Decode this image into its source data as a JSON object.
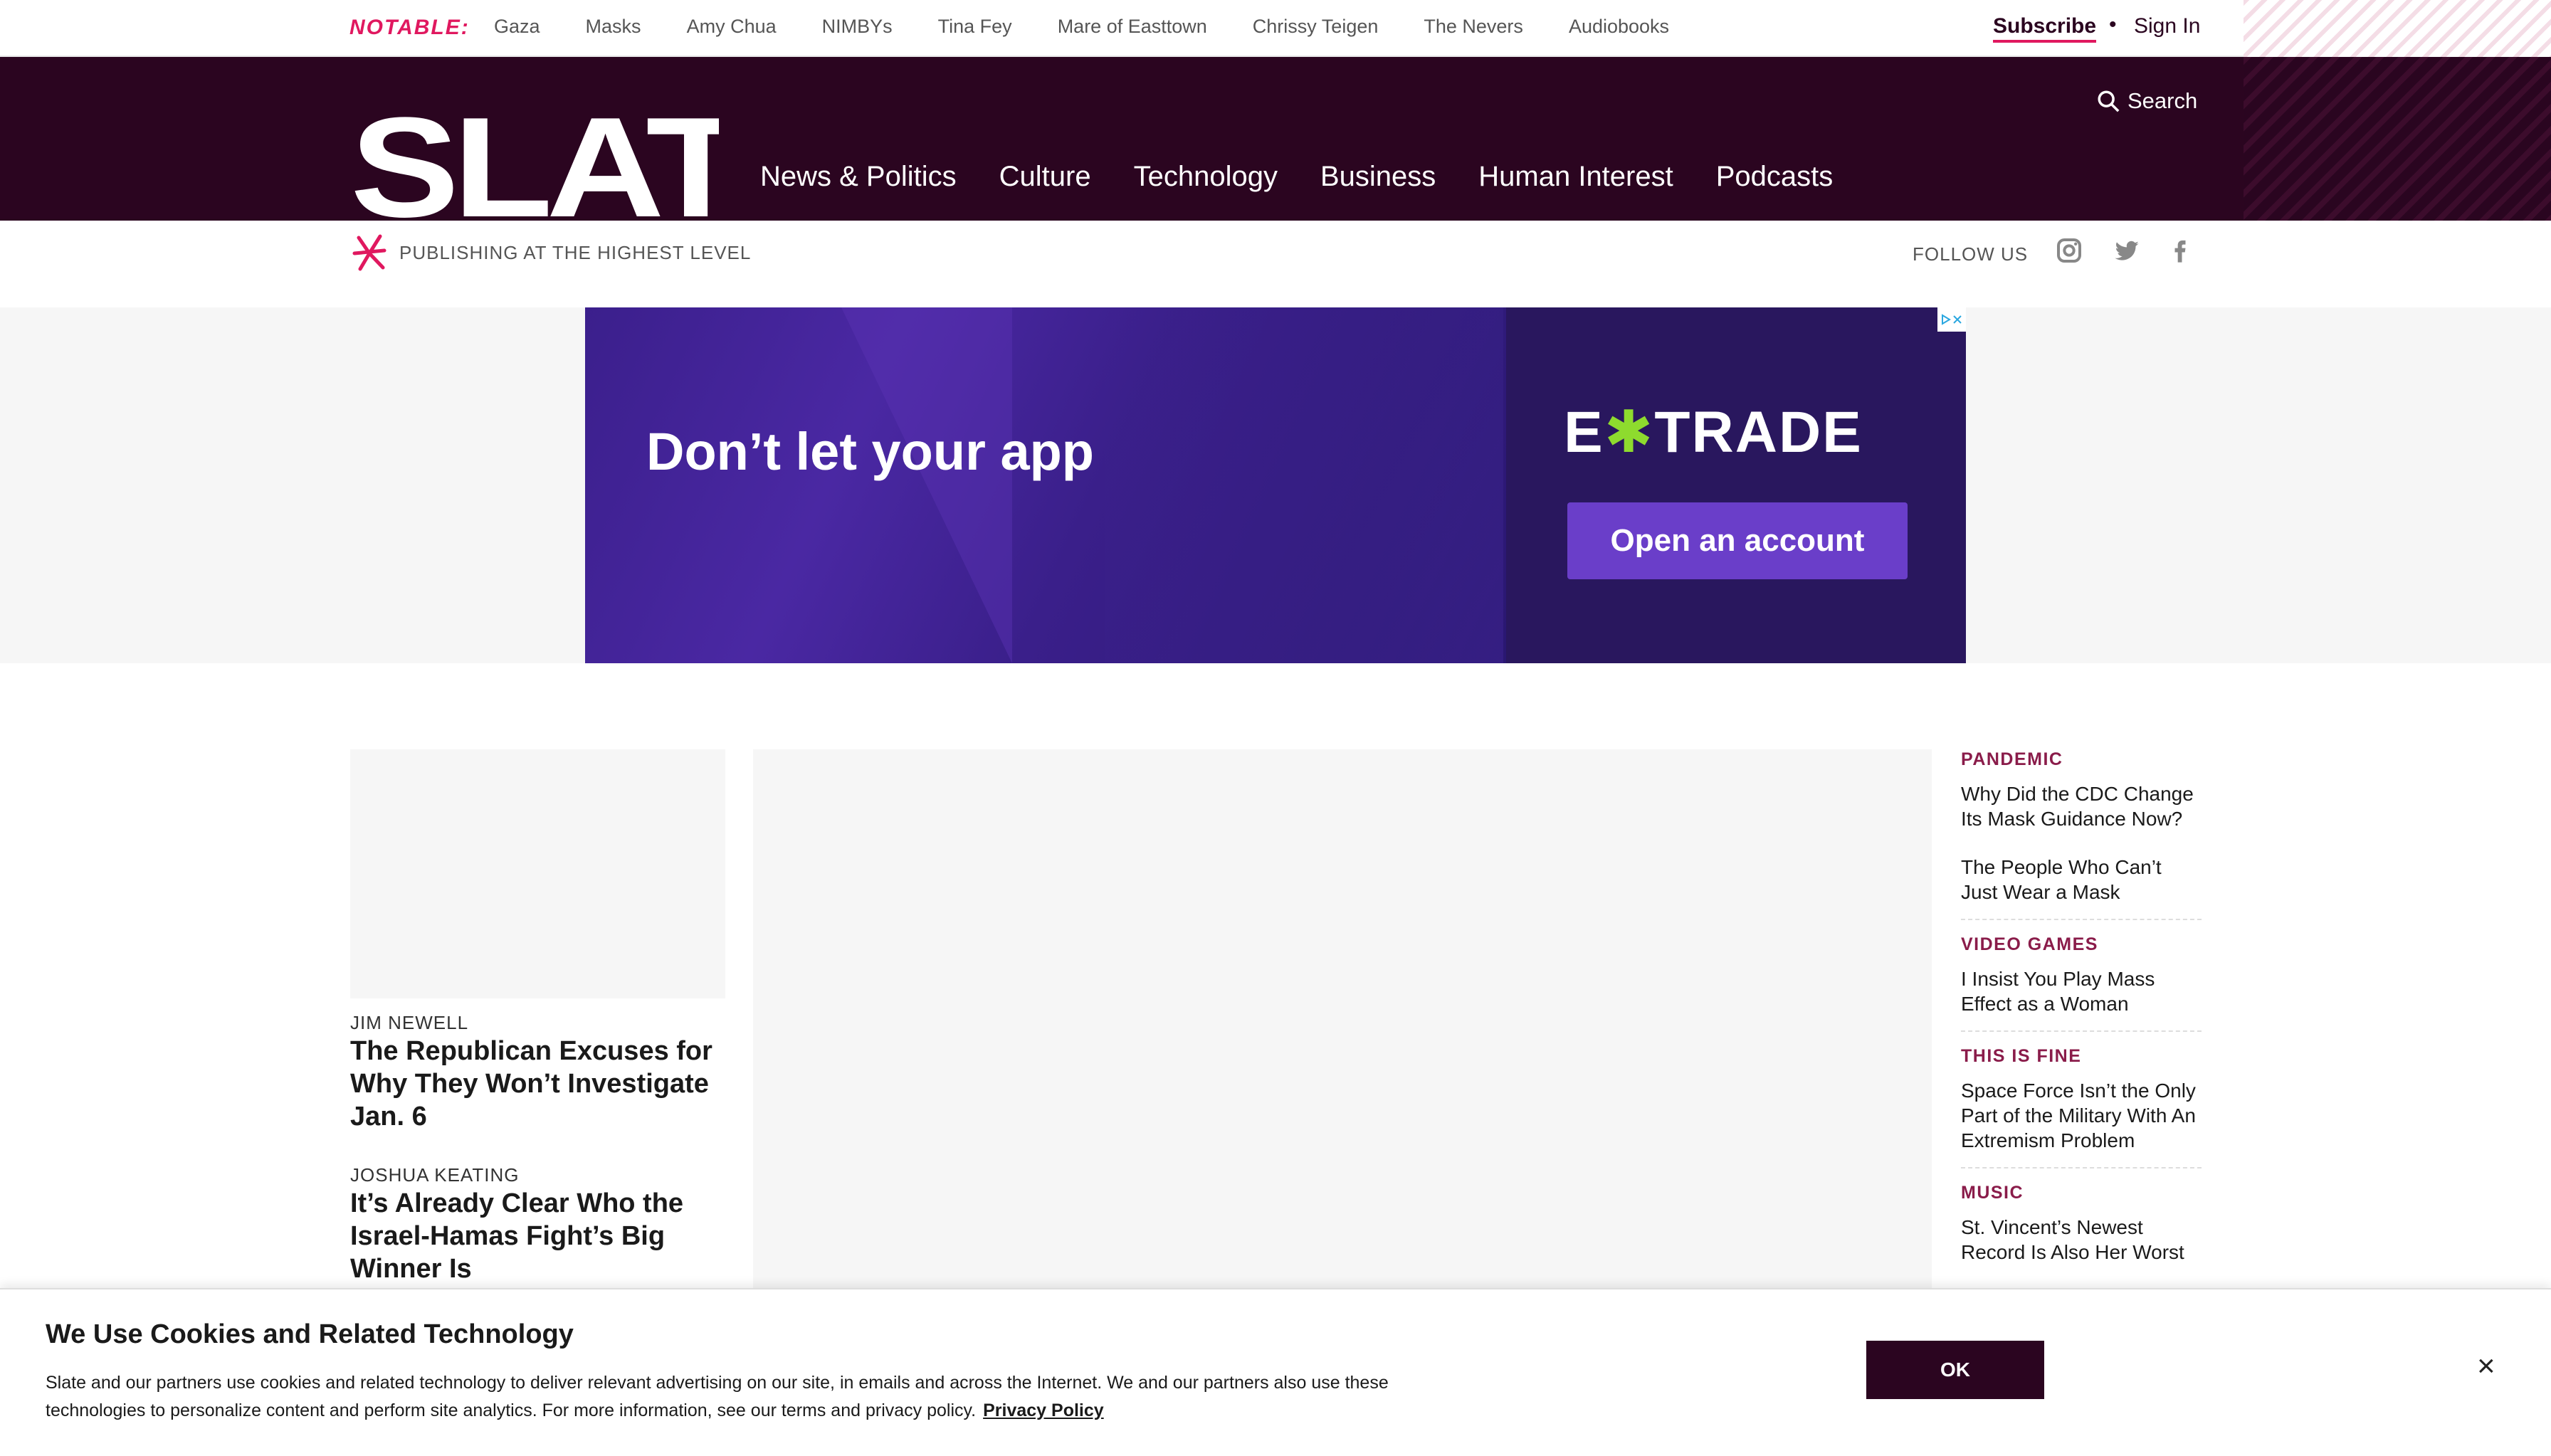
{
  "notable": {
    "label": "NOTABLE:",
    "links": [
      "Gaza",
      "Masks",
      "Amy Chua",
      "NIMBYs",
      "Tina Fey",
      "Mare of Easttown",
      "Chrissy Teigen",
      "The Nevers",
      "Audiobooks"
    ]
  },
  "account": {
    "subscribe": "Subscribe",
    "separator": "•",
    "sign_in": "Sign In"
  },
  "header": {
    "logo": "SLATE",
    "nav": [
      "News & Politics",
      "Culture",
      "Technology",
      "Business",
      "Human Interest",
      "Podcasts"
    ],
    "search_label": "Search"
  },
  "tagline": {
    "text": "PUBLISHING AT THE HIGHEST LEVEL",
    "follow_us": "FOLLOW US"
  },
  "ad": {
    "headline": "Don’t let your app",
    "brand_left": "E",
    "brand_x": "✱",
    "brand_right": "TRADE",
    "cta": "Open an account"
  },
  "stories": [
    {
      "author": "JIM NEWELL",
      "title": "The Republican Excuses for Why They Won’t Investigate Jan. 6"
    },
    {
      "author": "JOSHUA KEATING",
      "title": "It’s Already Clear Who the Israel-Hamas Fight’s Big Winner Is"
    }
  ],
  "sidebar": [
    {
      "kicker": "PANDEMIC",
      "links": [
        "Why Did the CDC Change Its Mask Guidance Now?",
        "The People Who Can’t Just Wear a Mask"
      ]
    },
    {
      "kicker": "VIDEO GAMES",
      "links": [
        "I Insist You Play Mass Effect as a Woman"
      ]
    },
    {
      "kicker": "THIS IS FINE",
      "links": [
        "Space Force Isn’t the Only Part of the Military With An Extremism Problem"
      ]
    },
    {
      "kicker": "MUSIC",
      "links": [
        "St. Vincent’s Newest Record Is Also Her Worst"
      ]
    }
  ],
  "cookie": {
    "title": "We Use Cookies and Related Technology",
    "body": "Slate and our partners use cookies and related technology to deliver relevant advertising on our site, in emails and across the Internet. We and our partners also use these technologies to personalize content and perform site analytics. For more information, see our terms and privacy policy.",
    "privacy_link": "Privacy Policy",
    "ok": "OK",
    "close": "×"
  },
  "colors": {
    "brand": "#2b0520",
    "accent": "#e0185f",
    "kicker": "#8a1c4a",
    "ad_cta": "#6a3ec9"
  },
  "icons": [
    "search-icon",
    "slate-star-icon",
    "instagram-icon",
    "twitter-icon",
    "facebook-icon",
    "adchoices-icon",
    "close-icon"
  ]
}
